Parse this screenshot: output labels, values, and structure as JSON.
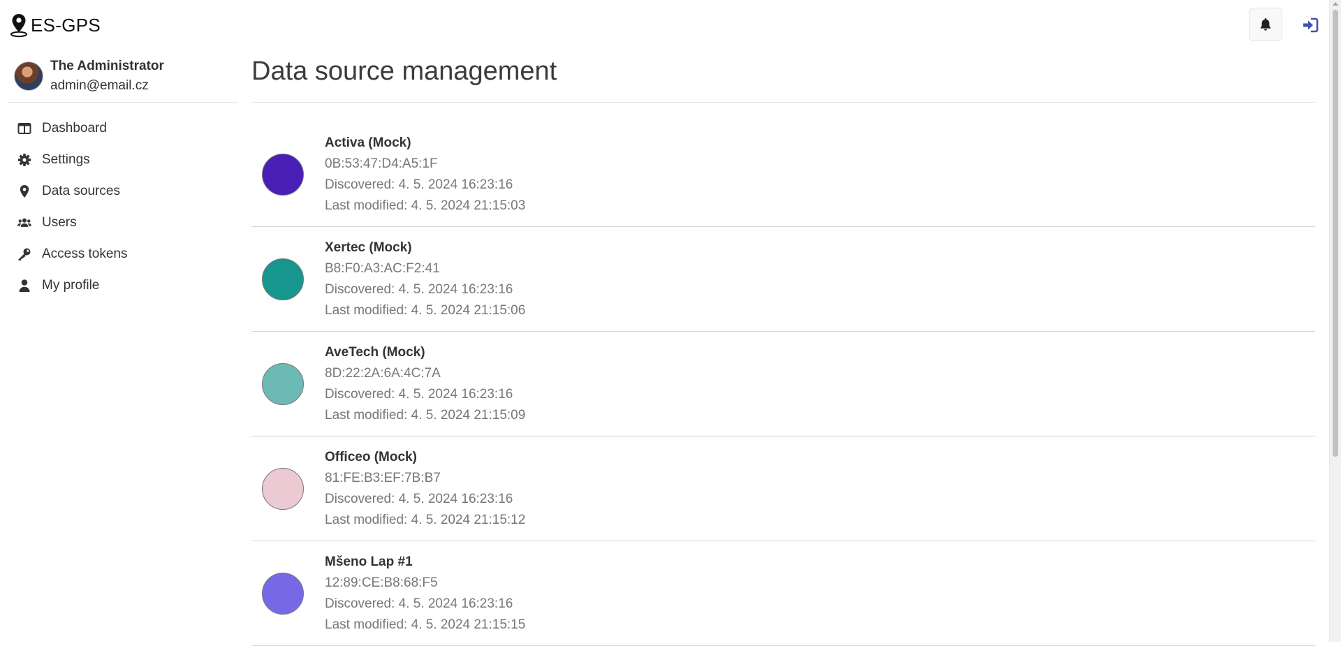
{
  "brand": {
    "name": "ES-GPS",
    "icon": "map-pin-person-icon"
  },
  "header": {
    "notifications_icon": "bell-icon",
    "login_icon": "sign-in-icon",
    "accent": "#3f51b5"
  },
  "user": {
    "name": "The Administrator",
    "email": "admin@email.cz"
  },
  "nav": {
    "items": [
      {
        "label": "Dashboard",
        "icon": "columns-icon"
      },
      {
        "label": "Settings",
        "icon": "gear-icon"
      },
      {
        "label": "Data sources",
        "icon": "map-marker-icon"
      },
      {
        "label": "Users",
        "icon": "users-icon"
      },
      {
        "label": "Access tokens",
        "icon": "key-icon"
      },
      {
        "label": "My profile",
        "icon": "user-icon"
      }
    ]
  },
  "main": {
    "title": "Data source management",
    "sources": [
      {
        "name": "Activa (Mock)",
        "mac": "0B:53:47:D4:A5:1F",
        "discovered": "Discovered: 4. 5. 2024 16:23:16",
        "modified": "Last modified: 4. 5. 2024 21:15:03",
        "color": "#4a1fb8"
      },
      {
        "name": "Xertec (Mock)",
        "mac": "B8:F0:A3:AC:F2:41",
        "discovered": "Discovered: 4. 5. 2024 16:23:16",
        "modified": "Last modified: 4. 5. 2024 21:15:06",
        "color": "#16968e"
      },
      {
        "name": "AveTech (Mock)",
        "mac": "8D:22:2A:6A:4C:7A",
        "discovered": "Discovered: 4. 5. 2024 16:23:16",
        "modified": "Last modified: 4. 5. 2024 21:15:09",
        "color": "#6bbab5"
      },
      {
        "name": "Officeo (Mock)",
        "mac": "81:FE:B3:EF:7B:B7",
        "discovered": "Discovered: 4. 5. 2024 16:23:16",
        "modified": "Last modified: 4. 5. 2024 21:15:12",
        "color": "#ebcad3"
      },
      {
        "name": "Mšeno Lap #1",
        "mac": "12:89:CE:B8:68:F5",
        "discovered": "Discovered: 4. 5. 2024 16:23:16",
        "modified": "Last modified: 4. 5. 2024 21:15:15",
        "color": "#7769e6"
      }
    ]
  }
}
